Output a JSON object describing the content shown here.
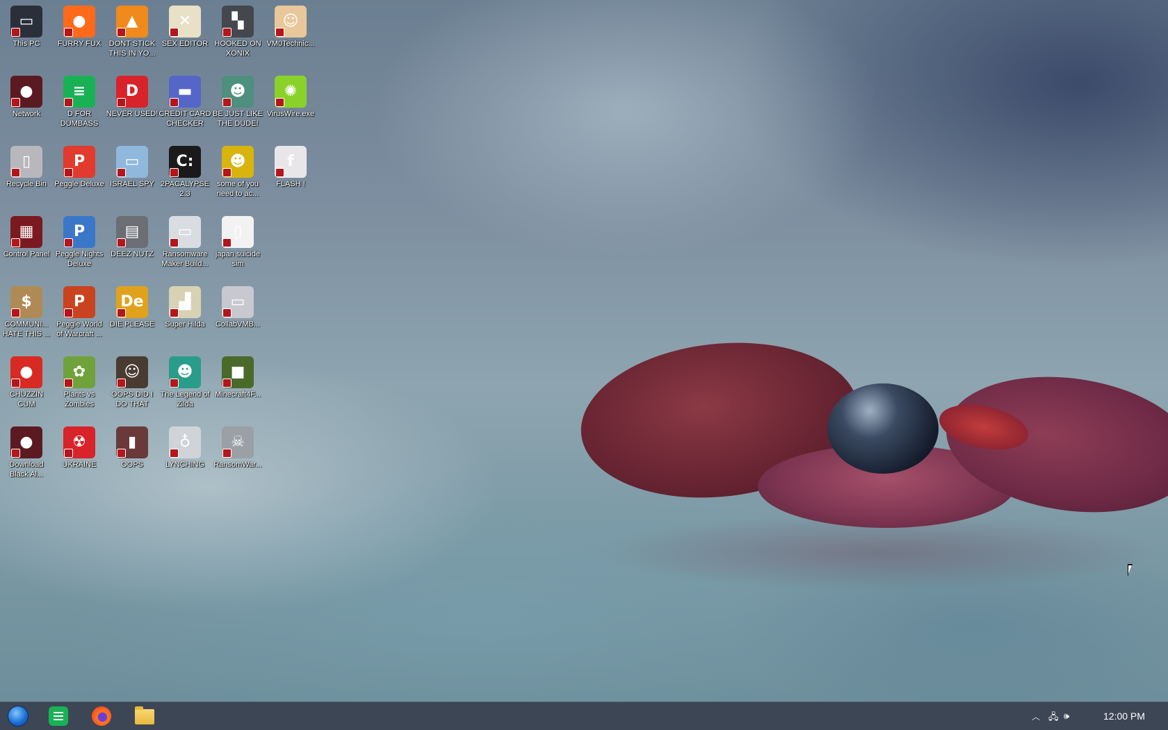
{
  "desktop": {
    "icons": [
      {
        "label": "This PC",
        "icon": "computer-icon",
        "color": "#2b2f3a",
        "glyph": "▭"
      },
      {
        "label": "FURRY FUX",
        "icon": "firefox-icon",
        "color": "#ff6a1a",
        "glyph": "●"
      },
      {
        "label": "DONT STICK THIS IN YO...",
        "icon": "vlc-cone-icon",
        "color": "#f08a1c",
        "glyph": "▲"
      },
      {
        "label": "SEX EDITOR",
        "icon": "hex-editor-icon",
        "color": "#e9e0c8",
        "glyph": "✕"
      },
      {
        "label": "HOOKED ON XONIX",
        "icon": "xonix-game-icon",
        "color": "#44474d",
        "glyph": "▚"
      },
      {
        "label": "VM0Technic...",
        "icon": "doctor-user-icon",
        "color": "#e9c79a",
        "glyph": "☺"
      },
      {
        "label": "Network",
        "icon": "network-orb-icon",
        "color": "#5b1a22",
        "glyph": "●"
      },
      {
        "label": "D FOR DUMBASS",
        "icon": "notes-app-icon",
        "color": "#18b255",
        "glyph": "≡"
      },
      {
        "label": "NEVER USED!",
        "icon": "devcpp-icon",
        "color": "#d8232a",
        "glyph": "D"
      },
      {
        "label": "CREDIT CARD CHECKER",
        "icon": "credit-card-icon",
        "color": "#5566c8",
        "glyph": "▬"
      },
      {
        "label": "BE JUST LIKE THE DUDE!",
        "icon": "santa-character-icon",
        "color": "#4e8f7e",
        "glyph": "☻"
      },
      {
        "label": "VirusWire.exe",
        "icon": "lime-icon",
        "color": "#8ad22a",
        "glyph": "✺"
      },
      {
        "label": "Recycle Bin",
        "icon": "recycle-bin-icon",
        "color": "#b8b8bc",
        "glyph": "▯"
      },
      {
        "label": "Peggle Deluxe",
        "icon": "peggle-icon",
        "color": "#e23a2c",
        "glyph": "P"
      },
      {
        "label": "ISRAEL SPY",
        "icon": "network-computers-icon",
        "color": "#8fb8dc",
        "glyph": "▭"
      },
      {
        "label": "2PACALYPSE 2.3",
        "icon": "command-prompt-icon",
        "color": "#1a1a1a",
        "glyph": "C:"
      },
      {
        "label": "some of you need to ac...",
        "icon": "bear-icon",
        "color": "#d8b40c",
        "glyph": "☻"
      },
      {
        "label": "FLASH !",
        "icon": "flash-file-icon",
        "color": "#e9e6ea",
        "glyph": "f"
      },
      {
        "label": "Control Panel",
        "icon": "control-panel-icon",
        "color": "#7a1a20",
        "glyph": "▦"
      },
      {
        "label": "Peggle Nights Deluxe",
        "icon": "peggle-nights-icon",
        "color": "#3b77c8",
        "glyph": "P"
      },
      {
        "label": "DEEZ NUTZ",
        "icon": "stacked-windows-icon",
        "color": "#6b6e73",
        "glyph": "▤"
      },
      {
        "label": "Ransomware Maker Build...",
        "icon": "window-app-icon",
        "color": "#d9dde2",
        "glyph": "▭"
      },
      {
        "label": "japan suicide sim",
        "icon": "document-icon",
        "color": "#f2f2f2",
        "glyph": "▯"
      },
      {
        "label": "COMMUNI... HATE THIS ...",
        "icon": "money-bag-icon",
        "color": "#b08a54",
        "glyph": "$"
      },
      {
        "label": "Peggle World of Warcraft ...",
        "icon": "peggle-wow-icon",
        "color": "#c8431e",
        "glyph": "P"
      },
      {
        "label": "DIE PLEASE",
        "icon": "de-editor-icon",
        "color": "#e0a21c",
        "glyph": "De"
      },
      {
        "label": "Super Hilda",
        "icon": "pixel-cat-icon",
        "color": "#d8d2b4",
        "glyph": "▟"
      },
      {
        "label": "CollabVMB...",
        "icon": "monitor-icon",
        "color": "#c8c8d0",
        "glyph": "▭"
      },
      {
        "label": "CHUZZIN CUM",
        "icon": "chuzzle-icon",
        "color": "#d82a22",
        "glyph": "●"
      },
      {
        "label": "Plants vs Zombies",
        "icon": "pvz-flower-icon",
        "color": "#6fa23a",
        "glyph": "✿"
      },
      {
        "label": "OOPS DID I DO THAT",
        "icon": "portrait-icon",
        "color": "#4a3b32",
        "glyph": "☺"
      },
      {
        "label": "The Legend of Zilda",
        "icon": "pixel-hero-icon",
        "color": "#2a9c8a",
        "glyph": "☻"
      },
      {
        "label": "Minecraft4F...",
        "icon": "grass-block-icon",
        "color": "#4a6a2a",
        "glyph": "■"
      },
      {
        "label": "Download Black Al...",
        "icon": "dark-orb-icon",
        "color": "#5b1a22",
        "glyph": "●"
      },
      {
        "label": "UKRAINE",
        "icon": "radiation-icon",
        "color": "#d8232a",
        "glyph": "☢"
      },
      {
        "label": "OOPS",
        "icon": "book-icon",
        "color": "#6a3a3a",
        "glyph": "▮"
      },
      {
        "label": "LYNCHING",
        "icon": "noose-icon",
        "color": "#d0d4d8",
        "glyph": "♁"
      },
      {
        "label": "RansomWar...",
        "icon": "skull-icon",
        "color": "#9aa0a6",
        "glyph": "☠"
      }
    ]
  },
  "taskbar": {
    "pinned": [
      {
        "name": "start-orb",
        "icon": "start-orb-icon"
      },
      {
        "name": "notes",
        "icon": "notes-app-icon"
      },
      {
        "name": "firefox",
        "icon": "firefox-icon"
      },
      {
        "name": "file-explorer",
        "icon": "folder-icon"
      }
    ],
    "tray": {
      "chevron": "︿",
      "network": "🖧",
      "volume": "🕪"
    },
    "clock": "12:00 PM"
  }
}
